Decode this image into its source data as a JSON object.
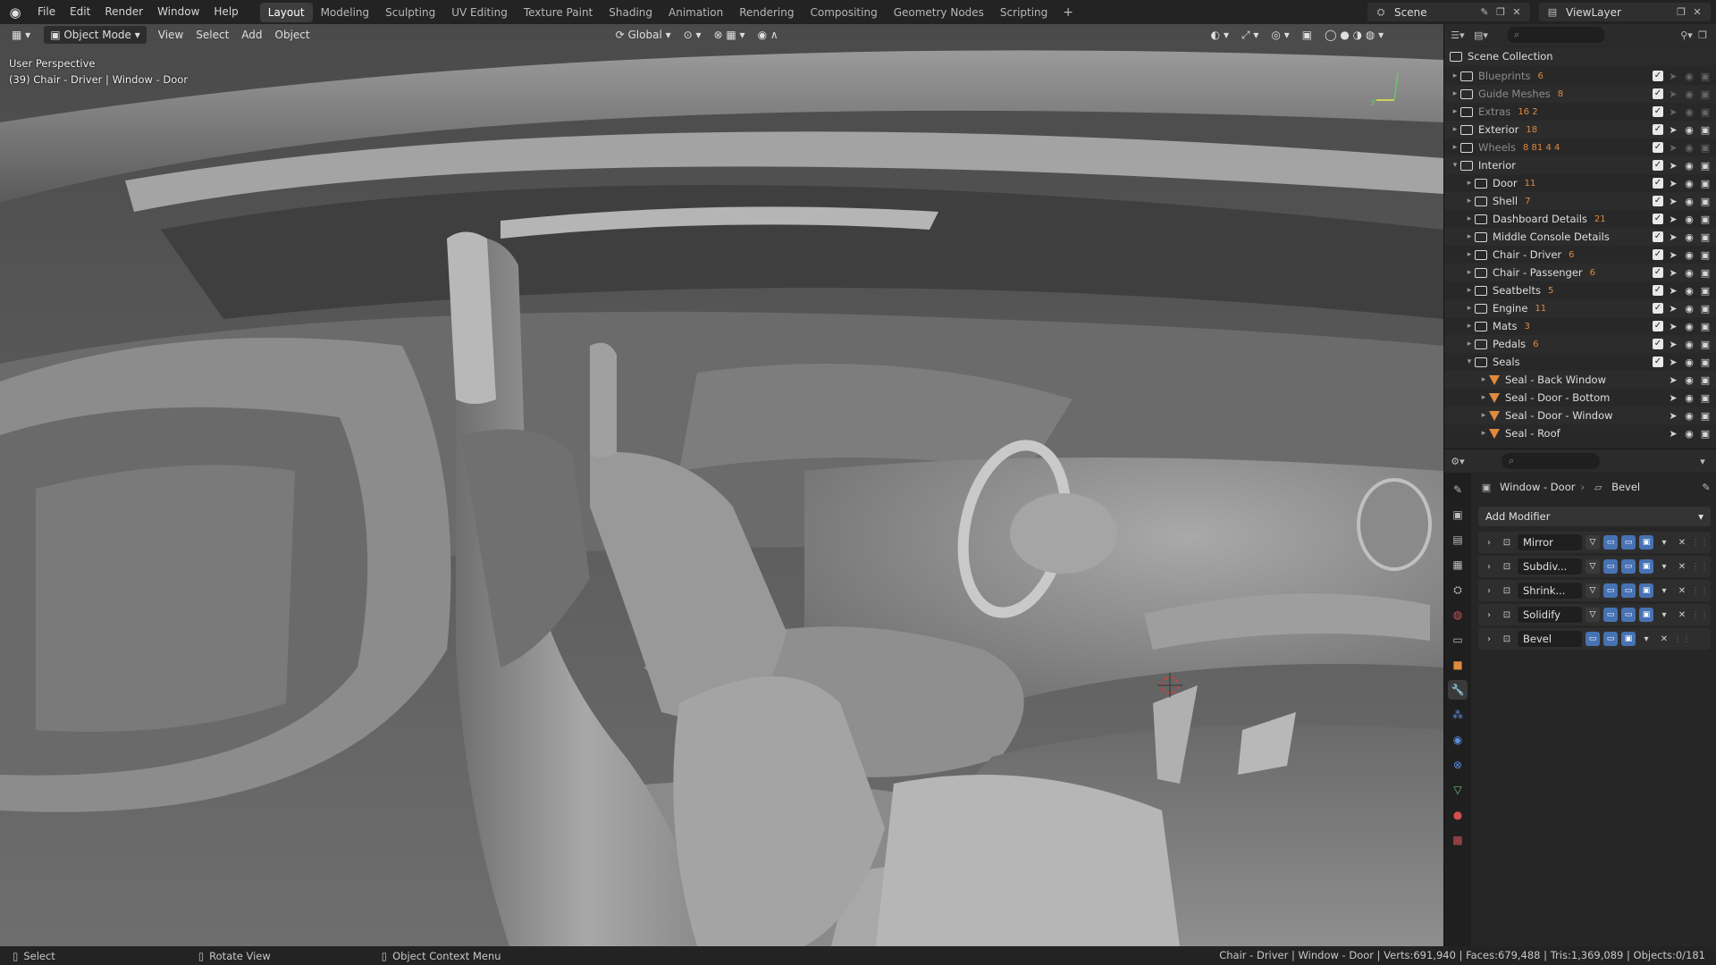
{
  "menu": [
    "File",
    "Edit",
    "Render",
    "Window",
    "Help"
  ],
  "workspaces": [
    "Layout",
    "Modeling",
    "Sculpting",
    "UV Editing",
    "Texture Paint",
    "Shading",
    "Animation",
    "Rendering",
    "Compositing",
    "Geometry Nodes",
    "Scripting"
  ],
  "active_workspace": "Layout",
  "scene": "Scene",
  "view_layer": "ViewLayer",
  "viewport": {
    "mode": "Object Mode",
    "menus": [
      "View",
      "Select",
      "Add",
      "Object"
    ],
    "transform": "Global",
    "perspective": "User Perspective",
    "active_object": "(39) Chair - Driver | Window - Door"
  },
  "outliner": {
    "root": "Scene Collection",
    "rows": [
      {
        "name": "Blueprints",
        "badge": "6",
        "dim": true,
        "level": 0,
        "expanded": false
      },
      {
        "name": "Guide Meshes",
        "badge": "8",
        "dim": true,
        "level": 0,
        "expanded": false
      },
      {
        "name": "Extras",
        "badge": "16  2",
        "dim": true,
        "level": 0,
        "expanded": false
      },
      {
        "name": "Exterior",
        "badge": "18",
        "dim": false,
        "level": 0,
        "expanded": false
      },
      {
        "name": "Wheels",
        "badge": "8  81  4  4",
        "dim": true,
        "level": 0,
        "expanded": false
      },
      {
        "name": "Interior",
        "badge": "",
        "dim": false,
        "level": 0,
        "expanded": true
      },
      {
        "name": "Door",
        "badge": "11",
        "dim": false,
        "level": 1,
        "expanded": false
      },
      {
        "name": "Shell",
        "badge": "7",
        "dim": false,
        "level": 1,
        "expanded": false
      },
      {
        "name": "Dashboard Details",
        "badge": "21",
        "dim": false,
        "level": 1,
        "expanded": false
      },
      {
        "name": "Middle Console Details",
        "badge": "",
        "dim": false,
        "level": 1,
        "expanded": false
      },
      {
        "name": "Chair - Driver",
        "badge": "6",
        "dim": false,
        "level": 1,
        "expanded": false
      },
      {
        "name": "Chair - Passenger",
        "badge": "6",
        "dim": false,
        "level": 1,
        "expanded": false
      },
      {
        "name": "Seatbelts",
        "badge": "5",
        "dim": false,
        "level": 1,
        "expanded": false
      },
      {
        "name": "Engine",
        "badge": "11",
        "dim": false,
        "level": 1,
        "expanded": false
      },
      {
        "name": "Mats",
        "badge": "3",
        "dim": false,
        "level": 1,
        "expanded": false
      },
      {
        "name": "Pedals",
        "badge": "6",
        "dim": false,
        "level": 1,
        "expanded": false
      },
      {
        "name": "Seals",
        "badge": "",
        "dim": false,
        "level": 1,
        "expanded": true
      },
      {
        "name": "Seal - Back Window",
        "badge": "",
        "dim": false,
        "level": 2,
        "object": true
      },
      {
        "name": "Seal - Door - Bottom",
        "badge": "",
        "dim": false,
        "level": 2,
        "object": true
      },
      {
        "name": "Seal - Door - Window",
        "badge": "",
        "dim": false,
        "level": 2,
        "object": true
      },
      {
        "name": "Seal - Roof",
        "badge": "",
        "dim": false,
        "level": 2,
        "object": true
      }
    ]
  },
  "properties": {
    "object": "Window - Door",
    "modifier_context": "Bevel",
    "add_modifier": "Add Modifier",
    "modifiers": [
      "Mirror",
      "Subdiv...",
      "Shrink...",
      "Solidify",
      "Bevel"
    ]
  },
  "statusbar": {
    "items": [
      "Select",
      "Rotate View",
      "Object Context Menu"
    ],
    "stats": "Chair - Driver | Window - Door | Verts:691,940 | Faces:679,488 | Tris:1,369,089 | Objects:0/181"
  },
  "colors": {
    "accent": "#4772b3",
    "object_orange": "#e08a3c",
    "bg": "#1d1d1d"
  }
}
